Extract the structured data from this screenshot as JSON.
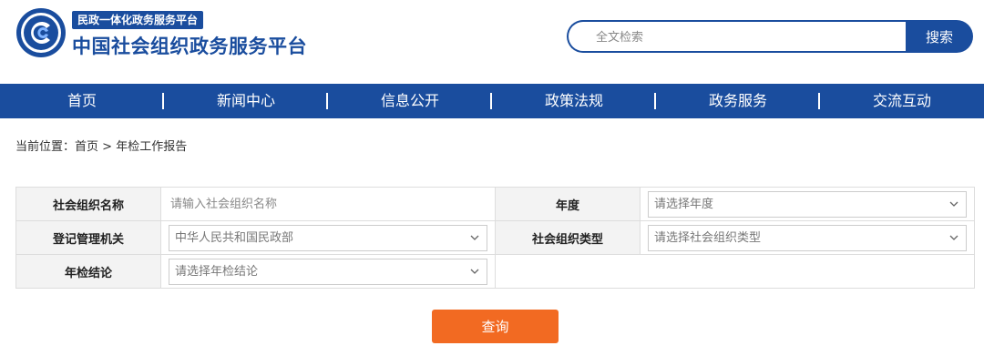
{
  "header": {
    "badge": "民政一体化政务服务平台",
    "title": "中国社会组织政务服务平台"
  },
  "search": {
    "placeholder": "全文检索",
    "button_label": "搜索"
  },
  "nav": {
    "items": [
      {
        "label": "首页"
      },
      {
        "label": "新闻中心"
      },
      {
        "label": "信息公开"
      },
      {
        "label": "政策法规"
      },
      {
        "label": "政务服务"
      },
      {
        "label": "交流互动"
      }
    ]
  },
  "breadcrumb": {
    "prefix": "当前位置：",
    "home": "首页",
    "separator": " > ",
    "current": "年检工作报告"
  },
  "form": {
    "org_name_label": "社会组织名称",
    "org_name_placeholder": "请输入社会组织名称",
    "year_label": "年度",
    "year_value": "请选择年度",
    "authority_label": "登记管理机关",
    "authority_value": "中华人民共和国民政部",
    "org_type_label": "社会组织类型",
    "org_type_value": "请选择社会组织类型",
    "conclusion_label": "年检结论",
    "conclusion_value": "请选择年检结论"
  },
  "query_button": "查询",
  "colors": {
    "brand_blue": "#1a4d9e",
    "accent_orange": "#f26a22"
  },
  "icons": {
    "logo": "emblem-logo",
    "dropdown": "chevron-down-icon"
  }
}
